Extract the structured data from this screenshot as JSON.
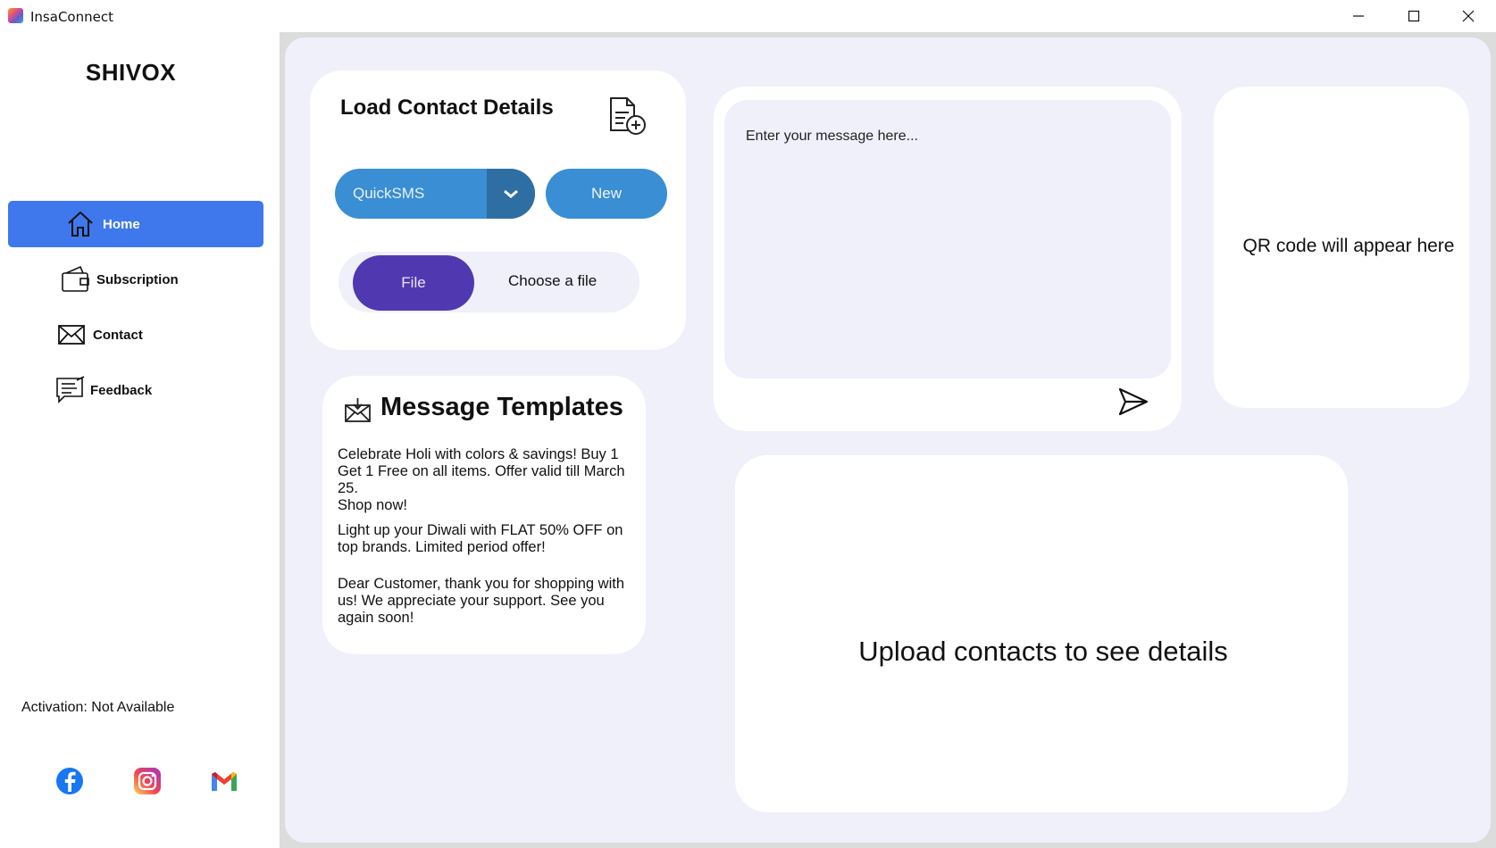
{
  "window": {
    "title": "InsaConnect",
    "icons": [
      "app-icon",
      "minimize-icon",
      "maximize-icon",
      "close-icon"
    ]
  },
  "sidebar": {
    "brand": "SHIVOX",
    "items": [
      {
        "label": "Home",
        "icon": "home-icon",
        "active": true
      },
      {
        "label": "Subscription",
        "icon": "wallet-icon",
        "active": false
      },
      {
        "label": "Contact",
        "icon": "envelope-icon",
        "active": false
      },
      {
        "label": "Feedback",
        "icon": "feedback-icon",
        "active": false
      }
    ],
    "activation": "Activation: Not Available",
    "social": [
      "facebook-icon",
      "instagram-icon",
      "gmail-icon"
    ]
  },
  "load_contacts": {
    "title": "Load Contact Details",
    "icon": "add-document-icon",
    "dropdown_value": "QuickSMS",
    "new_label": "New",
    "file_button_label": "File",
    "file_status": "Choose a file"
  },
  "templates": {
    "title": "Message Templates",
    "icon": "mail-icon",
    "items": [
      "Celebrate Holi with colors & savings! Buy 1 Get 1 Free on all items. Offer valid till March 25.\n Shop now!",
      "Light up your Diwali with FLAT 50% OFF on top brands. Limited period offer!",
      "Dear Customer, thank you for shopping with us! We appreciate your support. See you again soon!"
    ]
  },
  "message": {
    "placeholder": "Enter your message here...",
    "value": "",
    "send_icon": "send-icon"
  },
  "qr": {
    "text": "QR code will appear here"
  },
  "details": {
    "text": "Upload contacts to see details"
  },
  "colors": {
    "accent": "#3f78ed",
    "button_blue": "#3a8ed4",
    "dropdown_arrow_bg": "#2f6ea3",
    "file_purple": "#5039b0",
    "main_bg": "#eff0fa"
  }
}
